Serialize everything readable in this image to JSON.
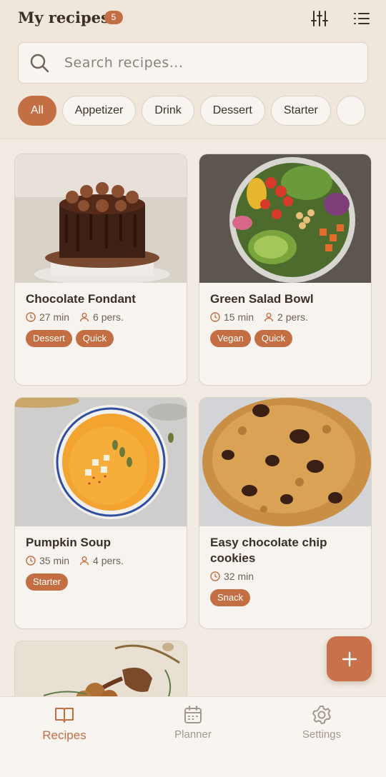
{
  "header": {
    "title": "My recipes",
    "count": "5",
    "filter_icon": "sliders-icon",
    "list_icon": "list-icon"
  },
  "search": {
    "placeholder": "Search recipes..."
  },
  "categories": [
    "All",
    "Appetizer",
    "Drink",
    "Dessert",
    "Starter"
  ],
  "active_category": "All",
  "recipes": [
    {
      "title": "Chocolate Fondant",
      "time": "27 min",
      "servings": "6 pers.",
      "tags": [
        "Dessert",
        "Quick"
      ]
    },
    {
      "title": "Green Salad Bowl",
      "time": "15 min",
      "servings": "2 pers.",
      "tags": [
        "Vegan",
        "Quick"
      ]
    },
    {
      "title": "Pumpkin Soup",
      "time": "35 min",
      "servings": "4 pers.",
      "tags": [
        "Starter"
      ]
    },
    {
      "title": "Easy chocolate chip cookies",
      "time": "32 min",
      "servings": "",
      "tags": [
        "Snack"
      ]
    }
  ],
  "fab": {
    "icon": "plus-icon"
  },
  "nav": {
    "recipes": "Recipes",
    "planner": "Planner",
    "settings": "Settings",
    "active": "Recipes"
  },
  "colors": {
    "accent": "#c46f43",
    "background": "#f1ebe3",
    "surface": "#f7f3ee"
  }
}
